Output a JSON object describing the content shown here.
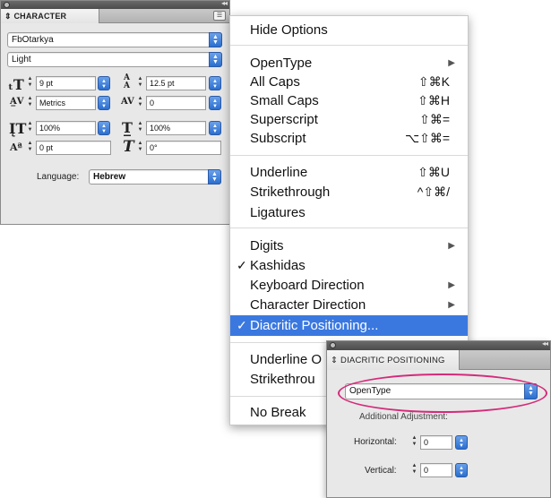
{
  "character_panel": {
    "tab_title": "CHARACTER",
    "font_family": "FbOtarkya",
    "font_style": "Light",
    "font_size": "9 pt",
    "leading": "12.5 pt",
    "kerning": "Metrics",
    "tracking": "0",
    "vertical_scale": "100%",
    "horizontal_scale": "100%",
    "baseline_shift": "0 pt",
    "skew": "0°",
    "language_label": "Language:",
    "language_value": "Hebrew"
  },
  "menu": {
    "hide_options": "Hide Options",
    "opentype": "OpenType",
    "all_caps": "All Caps",
    "all_caps_shortcut": "⇧⌘K",
    "small_caps": "Small Caps",
    "small_caps_shortcut": "⇧⌘H",
    "superscript": "Superscript",
    "superscript_shortcut": "⇧⌘=",
    "subscript": "Subscript",
    "subscript_shortcut": "⌥⇧⌘=",
    "underline": "Underline",
    "underline_shortcut": "⇧⌘U",
    "strikethrough": "Strikethrough",
    "strikethrough_shortcut": "^⇧⌘/",
    "ligatures": "Ligatures",
    "digits": "Digits",
    "kashidas": "Kashidas",
    "keyboard_direction": "Keyboard Direction",
    "character_direction": "Character Direction",
    "diacritic_positioning": "Diacritic Positioning...",
    "underline_options_partial": "Underline O",
    "strikethrough_options_partial": "Strikethrou",
    "no_break": "No Break",
    "check_mark": "✓",
    "submenu_arrow": "▶"
  },
  "diacritic_panel": {
    "tab_title": "DIACRITIC POSITIONING",
    "mode": "OpenType",
    "additional_adjustment_label": "Additional Adjustment:",
    "horizontal_label": "Horizontal:",
    "horizontal_value": "0",
    "vertical_label": "Vertical:",
    "vertical_value": "0"
  },
  "colors": {
    "menu_highlight": "#3a78e0",
    "annotation_ellipse": "#d42b7a",
    "select_arrow": "#2a6fd0"
  }
}
